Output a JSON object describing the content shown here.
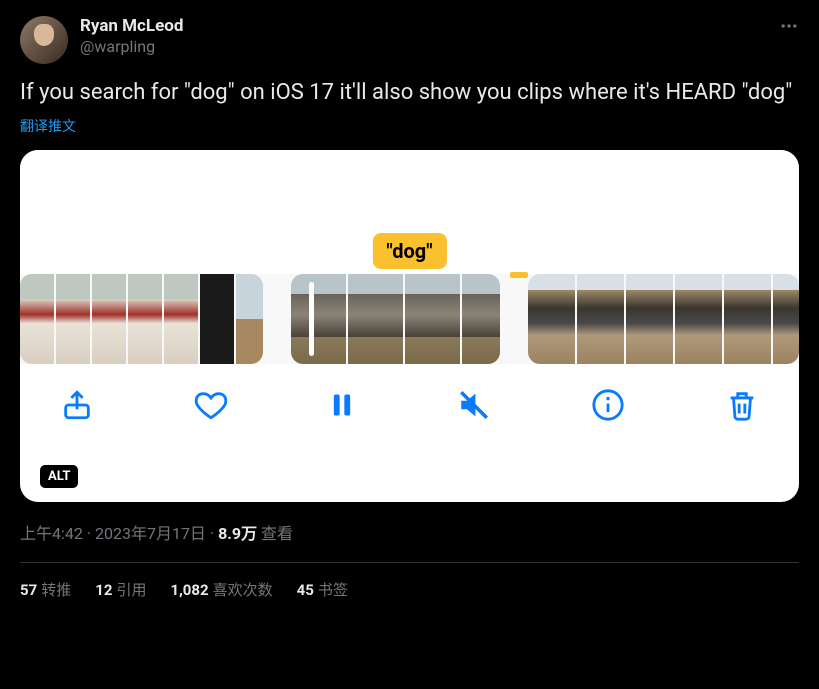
{
  "author": {
    "display_name": "Ryan McLeod",
    "handle": "@warpling"
  },
  "tweet_text": "If you search for \"dog\" on iOS 17 it'll also show you clips where it's HEARD \"dog\"",
  "translate_label": "翻译推文",
  "media": {
    "keyword_tag": "\"dog\"",
    "alt_badge": "ALT"
  },
  "meta": {
    "time": "上午4:42",
    "date": "2023年7月17日",
    "views_number": "8.9万",
    "views_label": "查看"
  },
  "stats": {
    "retweets_num": "57",
    "retweets_label": "转推",
    "quotes_num": "12",
    "quotes_label": "引用",
    "likes_num": "1,082",
    "likes_label": "喜欢次数",
    "bookmarks_num": "45",
    "bookmarks_label": "书签"
  }
}
